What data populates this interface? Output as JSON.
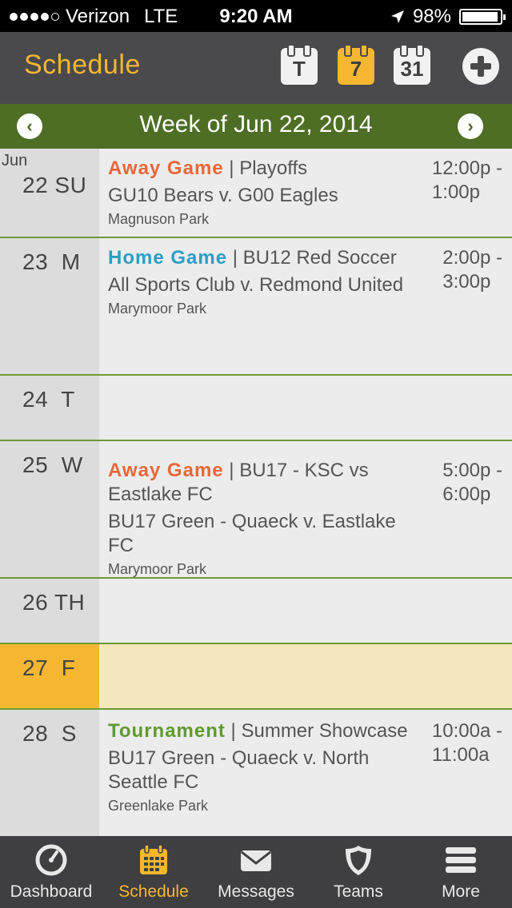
{
  "status_bar": {
    "carrier": "Verizon",
    "network": "LTE",
    "time": "9:20 AM",
    "battery": "98%",
    "signal_bars": 4
  },
  "header": {
    "title": "Schedule",
    "today_icon_label": "T",
    "week_icon_label": "7",
    "month_icon_label": "31"
  },
  "week_nav": {
    "label": "Week of Jun 22, 2014"
  },
  "days": [
    {
      "month": "Jun",
      "day": "22 SU",
      "event": {
        "type": "Away Game",
        "type_color": "#e8683a",
        "sep": " | ",
        "context": "Playoffs",
        "title": "GU10 Bears v. G00 Eagles",
        "location": "Magnuson Park",
        "time": "12:00p -\n1:00p"
      }
    },
    {
      "month": "",
      "day": "23  M",
      "event": {
        "type": "Home Game",
        "type_color": "#2a9fc4",
        "sep": " | ",
        "context": "BU12 Red Soccer",
        "title": "All Sports Club v. Redmond United",
        "location": "Marymoor Park",
        "time": "2:00p -\n3:00p"
      }
    },
    {
      "month": "",
      "day": "24  T",
      "event": null
    },
    {
      "month": "",
      "day": "25  W",
      "event": {
        "type": "Away Game",
        "type_color": "#e8683a",
        "sep": " | ",
        "context": "BU17 - KSC vs Eastlake FC",
        "title": "BU17 Green - Quaeck v. Eastlake FC",
        "location": "Marymoor Park",
        "time": "5:00p -\n6:00p"
      }
    },
    {
      "month": "",
      "day": "26 TH",
      "event": null
    },
    {
      "month": "",
      "day": "27  F",
      "event": null,
      "today": true
    },
    {
      "month": "",
      "day": "28  S",
      "event": {
        "type": "Tournament",
        "type_color": "#5e9a2d",
        "sep": " | ",
        "context": "Summer Showcase",
        "title": "BU17 Green - Quaeck v. North Seattle FC",
        "location": "Greenlake Park",
        "time": "10:00a -\n11:00a"
      }
    }
  ],
  "tabs": [
    {
      "label": "Dashboard",
      "icon": "dashboard-gauge-icon",
      "active": false
    },
    {
      "label": "Schedule",
      "icon": "calendar-icon",
      "active": true
    },
    {
      "label": "Messages",
      "icon": "envelope-icon",
      "active": false
    },
    {
      "label": "Teams",
      "icon": "shield-icon",
      "active": false
    },
    {
      "label": "More",
      "icon": "menu-icon",
      "active": false
    }
  ],
  "colors": {
    "header_bg": "#4a4a4d",
    "accent": "#f5b731",
    "week_bar": "#4e6e25",
    "divider": "#6d9a36"
  }
}
